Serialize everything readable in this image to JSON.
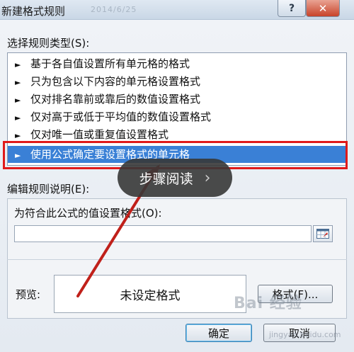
{
  "window": {
    "title": "新建格式规则",
    "ghost_text": "2014/6/25",
    "help_glyph": "?",
    "close_glyph": "✕"
  },
  "rule_type": {
    "label": "选择规则类型(S):",
    "items": [
      "基于各自值设置所有单元格的格式",
      "只为包含以下内容的单元格设置格式",
      "仅对排名靠前或靠后的数值设置格式",
      "仅对高于或低于平均值的数值设置格式",
      "仅对唯一值或重复值设置格式",
      "使用公式确定要设置格式的单元格"
    ],
    "selected_index": 5,
    "arrow_glyph": "►"
  },
  "rule_desc": {
    "label": "编辑规则说明(E):",
    "formula_label": "为符合此公式的值设置格式(O):",
    "formula_value": ""
  },
  "preview": {
    "label": "预览:",
    "text": "未设定格式",
    "format_button": "格式(F)..."
  },
  "footer": {
    "ok": "确定",
    "cancel": "取消"
  },
  "overlay": {
    "read_steps": "步骤阅读",
    "chevron": "›"
  },
  "watermark": {
    "text": "Bai 经验",
    "sub": "jingyan.baidu.com"
  },
  "colors": {
    "selection": "#3a80d6",
    "highlight_border": "#e01a1a",
    "annotation_arrow": "#c0201a"
  }
}
